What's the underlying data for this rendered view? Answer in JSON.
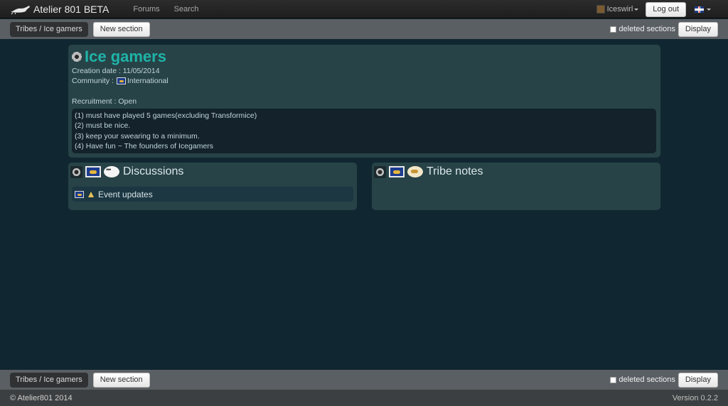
{
  "navbar": {
    "brand": "Atelier 801 BETA",
    "links": [
      "Forums",
      "Search"
    ],
    "username": "Iceswirl",
    "logout_label": "Log out",
    "language_icon": "uk-flag-icon"
  },
  "toolbar": {
    "breadcrumb": "Tribes / Ice gamers",
    "new_section_label": "New section",
    "deleted_sections_label": "deleted sections",
    "display_label": "Display"
  },
  "tribe": {
    "name": "Ice gamers",
    "creation_date": "Creation date : 11/05/2014",
    "community_label": "Community :",
    "community_value": "International",
    "recruitment": "Recruitment : Open",
    "rules": [
      "(1) must have played 5 games(excluding Transformice)",
      "(2) must be nice.",
      "(3) keep your swearing to a minimum.",
      "(4) Have fun ~ The founders of Icegamers"
    ]
  },
  "sections": {
    "discussions": {
      "title": "Discussions",
      "items": [
        "Event updates"
      ]
    },
    "notes": {
      "title": "Tribe notes"
    }
  },
  "footer": {
    "copyright": "© Atelier801 2014",
    "version": "Version 0.2.2"
  },
  "colors": {
    "background": "#102630",
    "panel": "#274347",
    "title_accent": "#1fb3a8",
    "toolbar": "#5a5f63"
  }
}
